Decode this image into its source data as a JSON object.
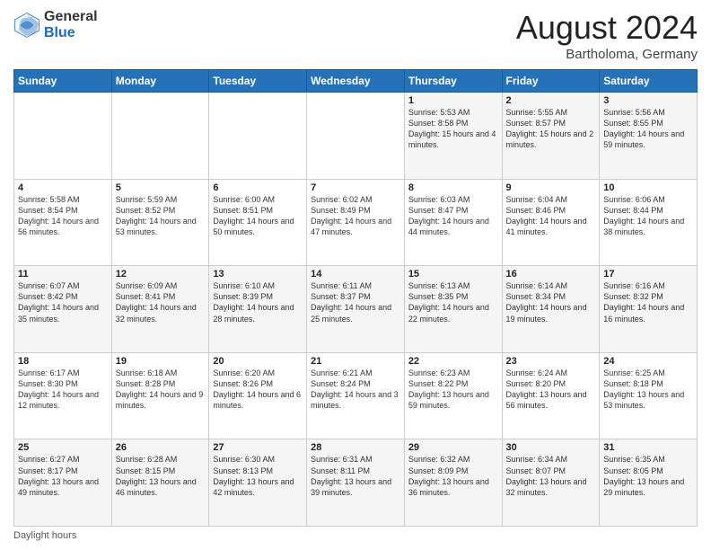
{
  "header": {
    "logo_general": "General",
    "logo_blue": "Blue",
    "month_title": "August 2024",
    "location": "Bartholoma, Germany"
  },
  "footer": {
    "label": "Daylight hours"
  },
  "columns": [
    "Sunday",
    "Monday",
    "Tuesday",
    "Wednesday",
    "Thursday",
    "Friday",
    "Saturday"
  ],
  "weeks": [
    {
      "row_bg": "light",
      "days": [
        {
          "num": "",
          "info": ""
        },
        {
          "num": "",
          "info": ""
        },
        {
          "num": "",
          "info": ""
        },
        {
          "num": "",
          "info": ""
        },
        {
          "num": "1",
          "info": "Sunrise: 5:53 AM\nSunset: 8:58 PM\nDaylight: 15 hours and 4 minutes."
        },
        {
          "num": "2",
          "info": "Sunrise: 5:55 AM\nSunset: 8:57 PM\nDaylight: 15 hours and 2 minutes."
        },
        {
          "num": "3",
          "info": "Sunrise: 5:56 AM\nSunset: 8:55 PM\nDaylight: 14 hours and 59 minutes."
        }
      ]
    },
    {
      "row_bg": "dark",
      "days": [
        {
          "num": "4",
          "info": "Sunrise: 5:58 AM\nSunset: 8:54 PM\nDaylight: 14 hours and 56 minutes."
        },
        {
          "num": "5",
          "info": "Sunrise: 5:59 AM\nSunset: 8:52 PM\nDaylight: 14 hours and 53 minutes."
        },
        {
          "num": "6",
          "info": "Sunrise: 6:00 AM\nSunset: 8:51 PM\nDaylight: 14 hours and 50 minutes."
        },
        {
          "num": "7",
          "info": "Sunrise: 6:02 AM\nSunset: 8:49 PM\nDaylight: 14 hours and 47 minutes."
        },
        {
          "num": "8",
          "info": "Sunrise: 6:03 AM\nSunset: 8:47 PM\nDaylight: 14 hours and 44 minutes."
        },
        {
          "num": "9",
          "info": "Sunrise: 6:04 AM\nSunset: 8:46 PM\nDaylight: 14 hours and 41 minutes."
        },
        {
          "num": "10",
          "info": "Sunrise: 6:06 AM\nSunset: 8:44 PM\nDaylight: 14 hours and 38 minutes."
        }
      ]
    },
    {
      "row_bg": "light",
      "days": [
        {
          "num": "11",
          "info": "Sunrise: 6:07 AM\nSunset: 8:42 PM\nDaylight: 14 hours and 35 minutes."
        },
        {
          "num": "12",
          "info": "Sunrise: 6:09 AM\nSunset: 8:41 PM\nDaylight: 14 hours and 32 minutes."
        },
        {
          "num": "13",
          "info": "Sunrise: 6:10 AM\nSunset: 8:39 PM\nDaylight: 14 hours and 28 minutes."
        },
        {
          "num": "14",
          "info": "Sunrise: 6:11 AM\nSunset: 8:37 PM\nDaylight: 14 hours and 25 minutes."
        },
        {
          "num": "15",
          "info": "Sunrise: 6:13 AM\nSunset: 8:35 PM\nDaylight: 14 hours and 22 minutes."
        },
        {
          "num": "16",
          "info": "Sunrise: 6:14 AM\nSunset: 8:34 PM\nDaylight: 14 hours and 19 minutes."
        },
        {
          "num": "17",
          "info": "Sunrise: 6:16 AM\nSunset: 8:32 PM\nDaylight: 14 hours and 16 minutes."
        }
      ]
    },
    {
      "row_bg": "dark",
      "days": [
        {
          "num": "18",
          "info": "Sunrise: 6:17 AM\nSunset: 8:30 PM\nDaylight: 14 hours and 12 minutes."
        },
        {
          "num": "19",
          "info": "Sunrise: 6:18 AM\nSunset: 8:28 PM\nDaylight: 14 hours and 9 minutes."
        },
        {
          "num": "20",
          "info": "Sunrise: 6:20 AM\nSunset: 8:26 PM\nDaylight: 14 hours and 6 minutes."
        },
        {
          "num": "21",
          "info": "Sunrise: 6:21 AM\nSunset: 8:24 PM\nDaylight: 14 hours and 3 minutes."
        },
        {
          "num": "22",
          "info": "Sunrise: 6:23 AM\nSunset: 8:22 PM\nDaylight: 13 hours and 59 minutes."
        },
        {
          "num": "23",
          "info": "Sunrise: 6:24 AM\nSunset: 8:20 PM\nDaylight: 13 hours and 56 minutes."
        },
        {
          "num": "24",
          "info": "Sunrise: 6:25 AM\nSunset: 8:18 PM\nDaylight: 13 hours and 53 minutes."
        }
      ]
    },
    {
      "row_bg": "light",
      "days": [
        {
          "num": "25",
          "info": "Sunrise: 6:27 AM\nSunset: 8:17 PM\nDaylight: 13 hours and 49 minutes."
        },
        {
          "num": "26",
          "info": "Sunrise: 6:28 AM\nSunset: 8:15 PM\nDaylight: 13 hours and 46 minutes."
        },
        {
          "num": "27",
          "info": "Sunrise: 6:30 AM\nSunset: 8:13 PM\nDaylight: 13 hours and 42 minutes."
        },
        {
          "num": "28",
          "info": "Sunrise: 6:31 AM\nSunset: 8:11 PM\nDaylight: 13 hours and 39 minutes."
        },
        {
          "num": "29",
          "info": "Sunrise: 6:32 AM\nSunset: 8:09 PM\nDaylight: 13 hours and 36 minutes."
        },
        {
          "num": "30",
          "info": "Sunrise: 6:34 AM\nSunset: 8:07 PM\nDaylight: 13 hours and 32 minutes."
        },
        {
          "num": "31",
          "info": "Sunrise: 6:35 AM\nSunset: 8:05 PM\nDaylight: 13 hours and 29 minutes."
        }
      ]
    }
  ]
}
